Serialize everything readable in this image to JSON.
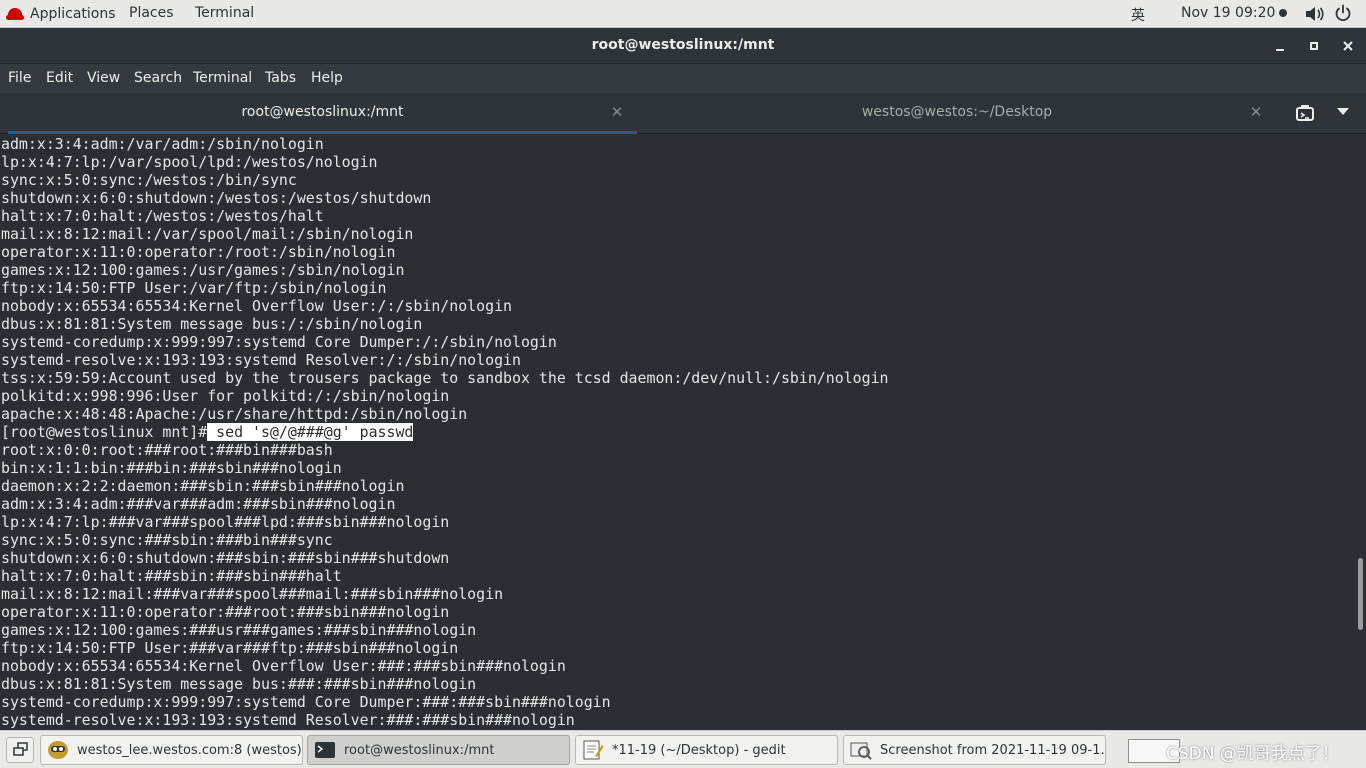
{
  "topbar": {
    "applications": "Applications",
    "places": "Places",
    "terminal": "Terminal",
    "input_method": "英",
    "clock": "Nov 19  09:20",
    "icons": [
      "redhat-logo-icon",
      "volume-icon",
      "power-icon"
    ]
  },
  "window": {
    "title": "root@westoslinux:/mnt",
    "buttons": [
      "minimize",
      "maximize",
      "close"
    ]
  },
  "menu": {
    "file": "File",
    "edit": "Edit",
    "view": "View",
    "search": "Search",
    "terminal": "Terminal",
    "tabs": "Tabs",
    "help": "Help"
  },
  "tabs": [
    {
      "label": "root@westoslinux:/mnt",
      "active": true
    },
    {
      "label": "westos@westos:~/Desktop",
      "active": false
    }
  ],
  "terminal": {
    "background": "#2b2e33",
    "foreground": "#e6e6e6",
    "lines": [
      "adm:x:3:4:adm:/var/adm:/sbin/nologin",
      "lp:x:4:7:lp:/var/spool/lpd:/westos/nologin",
      "sync:x:5:0:sync:/westos:/bin/sync",
      "shutdown:x:6:0:shutdown:/westos:/westos/shutdown",
      "halt:x:7:0:halt:/westos:/westos/halt",
      "mail:x:8:12:mail:/var/spool/mail:/sbin/nologin",
      "operator:x:11:0:operator:/root:/sbin/nologin",
      "games:x:12:100:games:/usr/games:/sbin/nologin",
      "ftp:x:14:50:FTP User:/var/ftp:/sbin/nologin",
      "nobody:x:65534:65534:Kernel Overflow User:/:/sbin/nologin",
      "dbus:x:81:81:System message bus:/:/sbin/nologin",
      "systemd-coredump:x:999:997:systemd Core Dumper:/:/sbin/nologin",
      "systemd-resolve:x:193:193:systemd Resolver:/:/sbin/nologin",
      "tss:x:59:59:Account used by the trousers package to sandbox the tcsd daemon:/dev/null:/sbin/nologin",
      "polkitd:x:998:996:User for polkitd:/:/sbin/nologin",
      "apache:x:48:48:Apache:/usr/share/httpd:/sbin/nologin"
    ],
    "prompt": "[root@westoslinux mnt]#",
    "command": " sed 's@/@###@g' passwd",
    "output": [
      "root:x:0:0:root:###root:###bin###bash",
      "bin:x:1:1:bin:###bin:###sbin###nologin",
      "daemon:x:2:2:daemon:###sbin:###sbin###nologin",
      "adm:x:3:4:adm:###var###adm:###sbin###nologin",
      "lp:x:4:7:lp:###var###spool###lpd:###sbin###nologin",
      "sync:x:5:0:sync:###sbin:###bin###sync",
      "shutdown:x:6:0:shutdown:###sbin:###sbin###shutdown",
      "halt:x:7:0:halt:###sbin:###sbin###halt",
      "mail:x:8:12:mail:###var###spool###mail:###sbin###nologin",
      "operator:x:11:0:operator:###root:###sbin###nologin",
      "games:x:12:100:games:###usr###games:###sbin###nologin",
      "ftp:x:14:50:FTP User:###var###ftp:###sbin###nologin",
      "nobody:x:65534:65534:Kernel Overflow User:###:###sbin###nologin",
      "dbus:x:81:81:System message bus:###:###sbin###nologin",
      "systemd-coredump:x:999:997:systemd Core Dumper:###:###sbin###nologin",
      "systemd-resolve:x:193:193:systemd Resolver:###:###sbin###nologin"
    ]
  },
  "taskbar": {
    "items": [
      {
        "label": "westos_lee.westos.com:8 (westos) ...",
        "icon": "vnc-viewer-icon",
        "active": false
      },
      {
        "label": "root@westoslinux:/mnt",
        "icon": "terminal-icon",
        "active": true
      },
      {
        "label": "*11-19 (~/Desktop) - gedit",
        "icon": "gedit-icon",
        "active": false
      },
      {
        "label": "Screenshot from 2021-11-19 09-1...",
        "icon": "image-viewer-icon",
        "active": false
      }
    ],
    "watermark": "CSDN @凯哥我点了！"
  }
}
